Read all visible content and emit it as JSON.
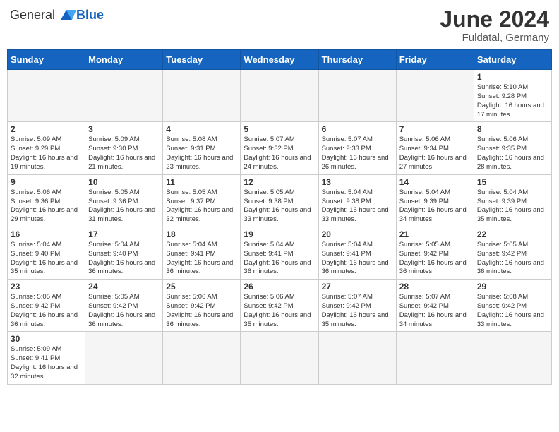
{
  "header": {
    "logo_general": "General",
    "logo_blue": "Blue",
    "month_year": "June 2024",
    "location": "Fuldatal, Germany"
  },
  "days_of_week": [
    "Sunday",
    "Monday",
    "Tuesday",
    "Wednesday",
    "Thursday",
    "Friday",
    "Saturday"
  ],
  "weeks": [
    [
      {
        "day": "",
        "info": ""
      },
      {
        "day": "",
        "info": ""
      },
      {
        "day": "",
        "info": ""
      },
      {
        "day": "",
        "info": ""
      },
      {
        "day": "",
        "info": ""
      },
      {
        "day": "",
        "info": ""
      },
      {
        "day": "1",
        "info": "Sunrise: 5:10 AM\nSunset: 9:28 PM\nDaylight: 16 hours and 17 minutes."
      }
    ],
    [
      {
        "day": "2",
        "info": "Sunrise: 5:09 AM\nSunset: 9:29 PM\nDaylight: 16 hours and 19 minutes."
      },
      {
        "day": "3",
        "info": "Sunrise: 5:09 AM\nSunset: 9:30 PM\nDaylight: 16 hours and 21 minutes."
      },
      {
        "day": "4",
        "info": "Sunrise: 5:08 AM\nSunset: 9:31 PM\nDaylight: 16 hours and 23 minutes."
      },
      {
        "day": "5",
        "info": "Sunrise: 5:07 AM\nSunset: 9:32 PM\nDaylight: 16 hours and 24 minutes."
      },
      {
        "day": "6",
        "info": "Sunrise: 5:07 AM\nSunset: 9:33 PM\nDaylight: 16 hours and 26 minutes."
      },
      {
        "day": "7",
        "info": "Sunrise: 5:06 AM\nSunset: 9:34 PM\nDaylight: 16 hours and 27 minutes."
      },
      {
        "day": "8",
        "info": "Sunrise: 5:06 AM\nSunset: 9:35 PM\nDaylight: 16 hours and 28 minutes."
      }
    ],
    [
      {
        "day": "9",
        "info": "Sunrise: 5:06 AM\nSunset: 9:36 PM\nDaylight: 16 hours and 29 minutes."
      },
      {
        "day": "10",
        "info": "Sunrise: 5:05 AM\nSunset: 9:36 PM\nDaylight: 16 hours and 31 minutes."
      },
      {
        "day": "11",
        "info": "Sunrise: 5:05 AM\nSunset: 9:37 PM\nDaylight: 16 hours and 32 minutes."
      },
      {
        "day": "12",
        "info": "Sunrise: 5:05 AM\nSunset: 9:38 PM\nDaylight: 16 hours and 33 minutes."
      },
      {
        "day": "13",
        "info": "Sunrise: 5:04 AM\nSunset: 9:38 PM\nDaylight: 16 hours and 33 minutes."
      },
      {
        "day": "14",
        "info": "Sunrise: 5:04 AM\nSunset: 9:39 PM\nDaylight: 16 hours and 34 minutes."
      },
      {
        "day": "15",
        "info": "Sunrise: 5:04 AM\nSunset: 9:39 PM\nDaylight: 16 hours and 35 minutes."
      }
    ],
    [
      {
        "day": "16",
        "info": "Sunrise: 5:04 AM\nSunset: 9:40 PM\nDaylight: 16 hours and 35 minutes."
      },
      {
        "day": "17",
        "info": "Sunrise: 5:04 AM\nSunset: 9:40 PM\nDaylight: 16 hours and 36 minutes."
      },
      {
        "day": "18",
        "info": "Sunrise: 5:04 AM\nSunset: 9:41 PM\nDaylight: 16 hours and 36 minutes."
      },
      {
        "day": "19",
        "info": "Sunrise: 5:04 AM\nSunset: 9:41 PM\nDaylight: 16 hours and 36 minutes."
      },
      {
        "day": "20",
        "info": "Sunrise: 5:04 AM\nSunset: 9:41 PM\nDaylight: 16 hours and 36 minutes."
      },
      {
        "day": "21",
        "info": "Sunrise: 5:05 AM\nSunset: 9:42 PM\nDaylight: 16 hours and 36 minutes."
      },
      {
        "day": "22",
        "info": "Sunrise: 5:05 AM\nSunset: 9:42 PM\nDaylight: 16 hours and 36 minutes."
      }
    ],
    [
      {
        "day": "23",
        "info": "Sunrise: 5:05 AM\nSunset: 9:42 PM\nDaylight: 16 hours and 36 minutes."
      },
      {
        "day": "24",
        "info": "Sunrise: 5:05 AM\nSunset: 9:42 PM\nDaylight: 16 hours and 36 minutes."
      },
      {
        "day": "25",
        "info": "Sunrise: 5:06 AM\nSunset: 9:42 PM\nDaylight: 16 hours and 36 minutes."
      },
      {
        "day": "26",
        "info": "Sunrise: 5:06 AM\nSunset: 9:42 PM\nDaylight: 16 hours and 35 minutes."
      },
      {
        "day": "27",
        "info": "Sunrise: 5:07 AM\nSunset: 9:42 PM\nDaylight: 16 hours and 35 minutes."
      },
      {
        "day": "28",
        "info": "Sunrise: 5:07 AM\nSunset: 9:42 PM\nDaylight: 16 hours and 34 minutes."
      },
      {
        "day": "29",
        "info": "Sunrise: 5:08 AM\nSunset: 9:42 PM\nDaylight: 16 hours and 33 minutes."
      }
    ],
    [
      {
        "day": "30",
        "info": "Sunrise: 5:09 AM\nSunset: 9:41 PM\nDaylight: 16 hours and 32 minutes."
      },
      {
        "day": "",
        "info": ""
      },
      {
        "day": "",
        "info": ""
      },
      {
        "day": "",
        "info": ""
      },
      {
        "day": "",
        "info": ""
      },
      {
        "day": "",
        "info": ""
      },
      {
        "day": "",
        "info": ""
      }
    ]
  ]
}
